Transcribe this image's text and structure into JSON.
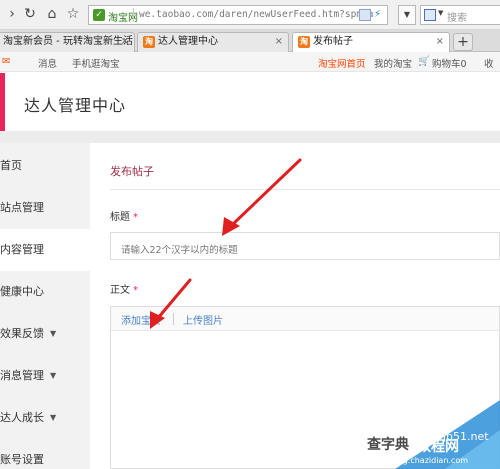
{
  "browser": {
    "site_badge": "淘宝网",
    "url": "we.taobao.com/daren/newUserFeed.htm?spm=a",
    "search_placeholder": "搜索",
    "tabs": [
      {
        "label": "淘宝新会员 - 玩转淘宝新生活",
        "close": "×"
      },
      {
        "label": "达人管理中心",
        "close": "×"
      },
      {
        "label": "发布帖子",
        "close": "×"
      }
    ],
    "new_tab": "+"
  },
  "site_nav": {
    "message": "消息",
    "mobile": "手机逛淘宝",
    "home": "淘宝网首页",
    "my_taobao": "我的淘宝",
    "cart": "购物车0",
    "more": "收"
  },
  "header": {
    "title": "达人管理中心",
    "accent_color": "#e8245c"
  },
  "sidebar": {
    "items": [
      {
        "label": "首页",
        "has_caret": false
      },
      {
        "label": "站点管理",
        "has_caret": false
      },
      {
        "label": "内容管理",
        "has_caret": false,
        "active": true
      },
      {
        "label": "健康中心",
        "has_caret": false
      },
      {
        "label": "效果反馈",
        "has_caret": true
      },
      {
        "label": "消息管理",
        "has_caret": true
      },
      {
        "label": "达人成长",
        "has_caret": true
      },
      {
        "label": "账号设置",
        "has_caret": false
      }
    ],
    "caret": "▼"
  },
  "main": {
    "section_title": "发布帖子",
    "title_label": "标题",
    "title_placeholder": "请输入22个汉字以内的标题",
    "body_label": "正文",
    "required_mark": "*",
    "toolbar": {
      "add_item": "添加宝贝",
      "upload_image": "上传图片"
    }
  },
  "watermark": {
    "line1": "查字典",
    "line2": "教程网",
    "domain": "jb51.net",
    "url": "jiaocheng.chazidian.com"
  },
  "colors": {
    "arrow": "#e02020",
    "link": "#4a82c8",
    "section_title": "#a0304a"
  }
}
